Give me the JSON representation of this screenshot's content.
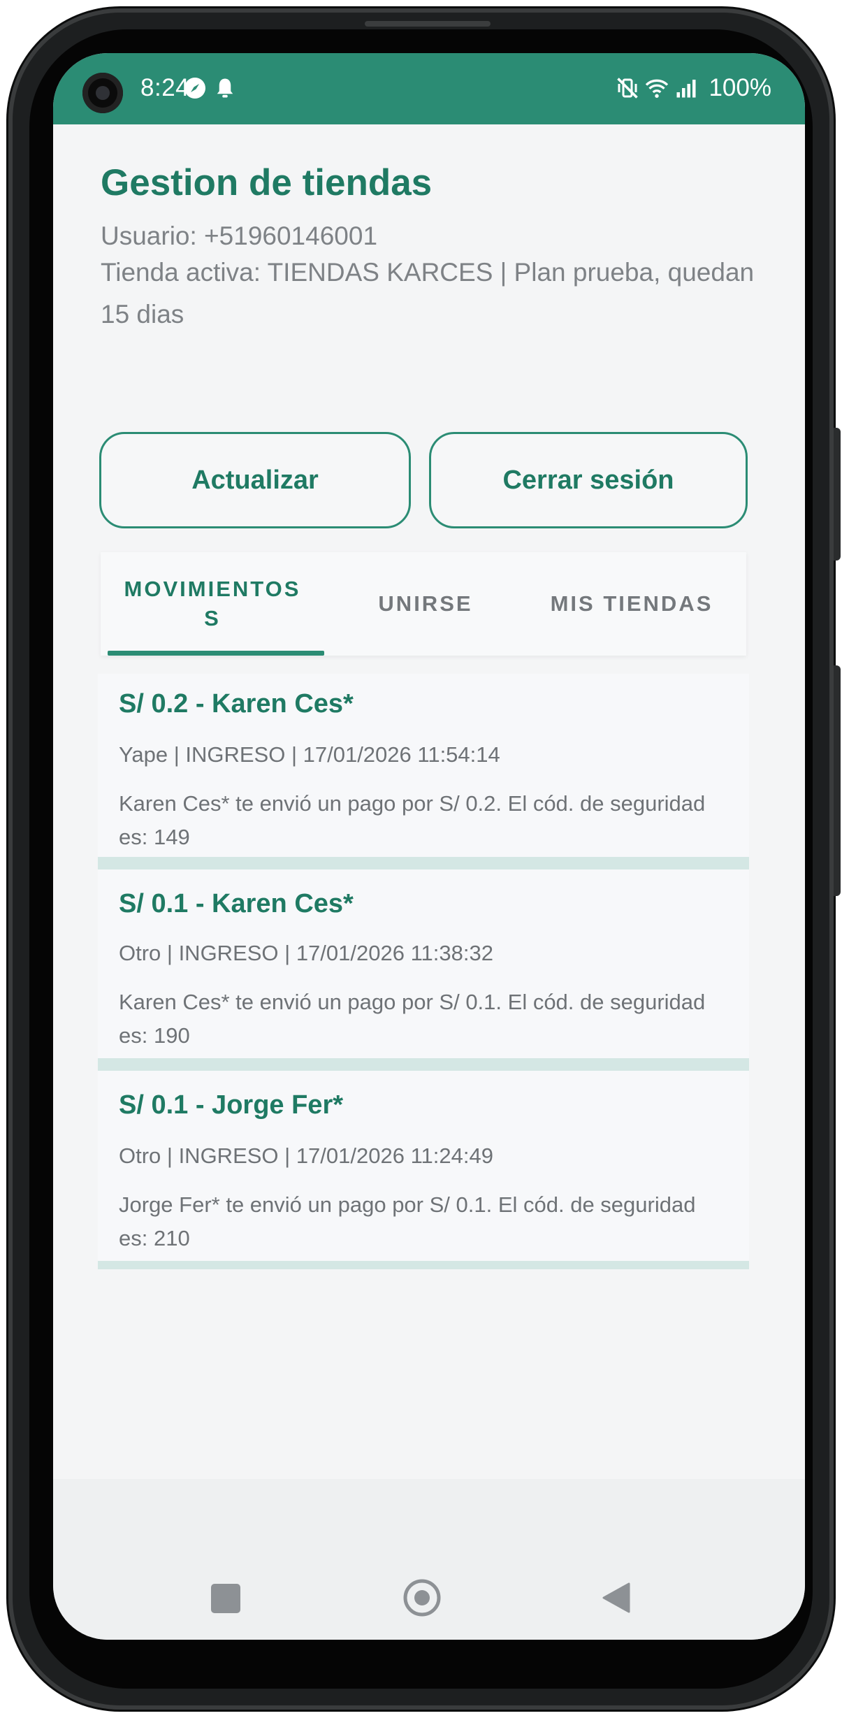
{
  "status_bar": {
    "time": "8:24",
    "battery": "100%",
    "icons": [
      "camera-cutout",
      "compass-icon",
      "notification-bell-icon",
      "vibrate-off-icon",
      "wifi-icon",
      "signal-icon"
    ]
  },
  "header": {
    "title": "Gestion de tiendas",
    "user_line": "Usuario: +51960146001",
    "store_line": "Tienda activa: TIENDAS KARCES | Plan  prueba, quedan 15 dias"
  },
  "actions": {
    "refresh_label": "Actualizar",
    "logout_label": "Cerrar sesión"
  },
  "tabs": [
    {
      "label": "MOVIMIENTOS",
      "label_overflow": "S",
      "active": true
    },
    {
      "label": "UNIRSE",
      "active": false
    },
    {
      "label": "MIS TIENDAS",
      "active": false
    }
  ],
  "movements": [
    {
      "title": "S/ 0.2 - Karen Ces*",
      "meta": "Yape | INGRESO | 17/01/2026 11:54:14",
      "description": "Karen Ces* te envió un pago por S/ 0.2. El cód. de seguridad es: 149"
    },
    {
      "title": "S/ 0.1 - Karen Ces*",
      "meta": "Otro | INGRESO | 17/01/2026 11:38:32",
      "description": "Karen Ces* te envió un pago por S/ 0.1. El cód. de seguridad es: 190"
    },
    {
      "title": "S/ 0.1 - Jorge Fer*",
      "meta": "Otro | INGRESO | 17/01/2026 11:24:49",
      "description": "Jorge Fer* te envió un pago por S/ 0.1. El cód. de seguridad es: 210"
    }
  ],
  "nav_bar": {
    "icons": [
      "recents-square-icon",
      "home-circle-icon",
      "back-triangle-icon"
    ]
  },
  "colors": {
    "accent": "#2b8c74",
    "title_green": "#1f7a63",
    "text_gray": "#7e8286",
    "divider": "#d4e7e4",
    "screen_bg": "#f4f5f6"
  }
}
